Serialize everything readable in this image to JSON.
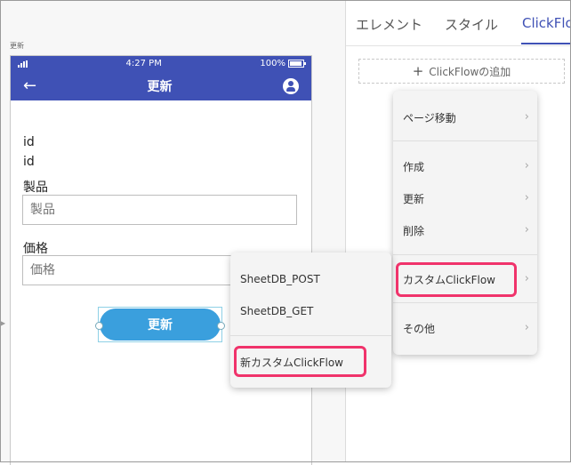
{
  "canvas": {
    "screen_caption": "更新",
    "phone": {
      "time": "4:27 PM",
      "battery": "100%",
      "battery_level": 1.0,
      "title": "更新",
      "id_line1": "id",
      "id_line2": "id",
      "product_label": "製品",
      "product_placeholder": "製品",
      "price_label": "価格",
      "price_placeholder": "価格",
      "update_button": "更新"
    }
  },
  "right_panel": {
    "tabs": [
      {
        "label": "エレメント",
        "active": false
      },
      {
        "label": "スタイル",
        "active": false
      },
      {
        "label": "ClickFlow",
        "active": true
      }
    ],
    "add_clickflow": "ClickFlowの追加"
  },
  "main_menu": {
    "items": [
      {
        "label": "ページ移動"
      },
      {
        "label": "作成"
      },
      {
        "label": "更新"
      },
      {
        "label": "削除"
      },
      {
        "label": "カスタムClickFlow",
        "highlighted": true
      },
      {
        "label": "その他"
      }
    ]
  },
  "sub_menu": {
    "items": [
      {
        "label": "SheetDB_POST"
      },
      {
        "label": "SheetDB_GET"
      },
      {
        "label": "新カスタムClickFlow",
        "highlighted": true
      }
    ]
  },
  "colors": {
    "appbar": "#3f51b5",
    "button": "#3a9fdd",
    "active_tab": "#3f51b5",
    "highlight": "#f0336b"
  },
  "icons": [
    "signal-icon",
    "battery-icon",
    "back-arrow-icon",
    "account-circle-icon",
    "plus-icon",
    "chevron-right-icon"
  ]
}
